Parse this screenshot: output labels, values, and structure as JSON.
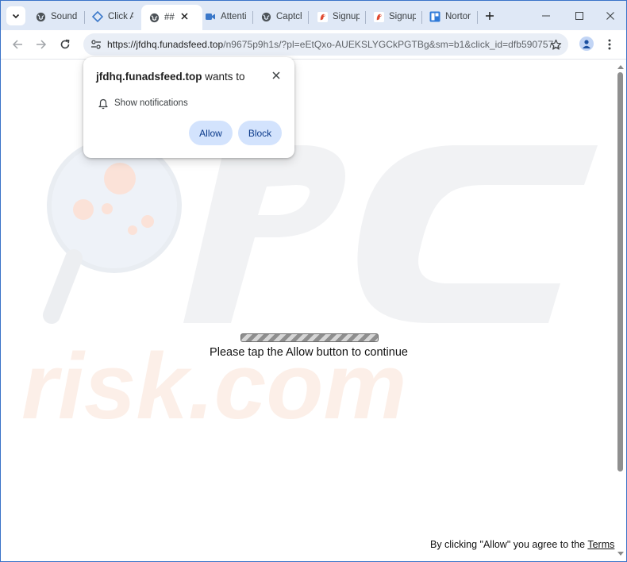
{
  "tabs": [
    {
      "label": "Sound",
      "icon": "globe-icon",
      "active": false
    },
    {
      "label": "Click A",
      "icon": "puzzle-icon",
      "active": false
    },
    {
      "label": "##",
      "icon": "globe-icon",
      "active": true
    },
    {
      "label": "Attenti",
      "icon": "video-icon",
      "active": false
    },
    {
      "label": "Captch",
      "icon": "globe-icon",
      "active": false
    },
    {
      "label": "Signup",
      "icon": "bird-icon",
      "active": false
    },
    {
      "label": "Signup",
      "icon": "bird-icon",
      "active": false
    },
    {
      "label": "Norton",
      "icon": "norton-icon",
      "active": false
    }
  ],
  "toolbar": {
    "url_host": "https://jfdhq.funadsfeed.top",
    "url_path": "/n9675p9h1s/?pl=eEtQxo-AUEKSLYGCkPGTBg&sm=b1&click_id=dfb590757..."
  },
  "popup": {
    "site": "jfdhq.funadsfeed.top",
    "wants_to": "wants to",
    "permission": "Show notifications",
    "allow_label": "Allow",
    "block_label": "Block"
  },
  "page": {
    "message": "Please tap the Allow button to continue",
    "agree_text": "By clicking \"Allow\" you agree to the",
    "terms_link": "Terms"
  },
  "colors": {
    "tabstrip": "#dfe8f6",
    "omnibox": "#e9eef6",
    "button_bg": "#d3e3fd",
    "button_text": "#0b3a8a",
    "window_border": "#3a73c8"
  }
}
